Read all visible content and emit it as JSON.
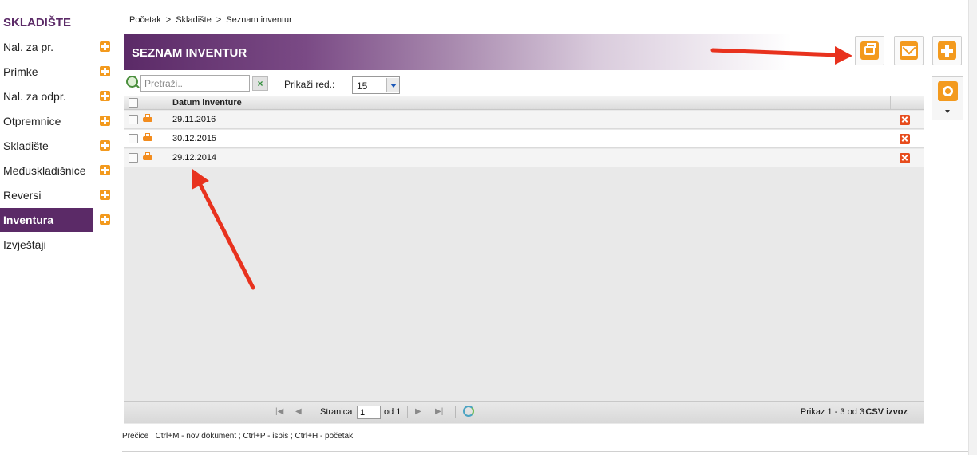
{
  "sidebar": {
    "title": "SKLADIŠTE",
    "items": [
      {
        "label": "Nal. za pr.",
        "has_add": true,
        "active": false
      },
      {
        "label": "Primke",
        "has_add": true,
        "active": false
      },
      {
        "label": "Nal. za odpr.",
        "has_add": true,
        "active": false
      },
      {
        "label": "Otpremnice",
        "has_add": true,
        "active": false
      },
      {
        "label": "Skladište",
        "has_add": true,
        "active": false
      },
      {
        "label": "Međuskladišnice",
        "has_add": true,
        "active": false
      },
      {
        "label": "Reversi",
        "has_add": true,
        "active": false
      },
      {
        "label": "Inventura",
        "has_add": true,
        "active": true
      },
      {
        "label": "Izvještaji",
        "has_add": false,
        "active": false
      }
    ]
  },
  "breadcrumb": {
    "items": [
      "Početak",
      "Skladište",
      "Seznam inventur"
    ],
    "separator": ">"
  },
  "header": {
    "title": "SEZNAM INVENTUR"
  },
  "actions": [
    {
      "name": "print",
      "icon": "printer-icon"
    },
    {
      "name": "email",
      "icon": "envelope-icon"
    },
    {
      "name": "add",
      "icon": "plus-icon"
    }
  ],
  "settings": {
    "icon": "gear-icon"
  },
  "toolbar": {
    "search_placeholder": "Pretraži..",
    "search_value": "",
    "clear_label": "×",
    "rows_label": "Prikaži red.:",
    "rows_value": "15"
  },
  "table": {
    "columns": [
      "Datum inventure"
    ],
    "rows": [
      {
        "date": "29.11.2016"
      },
      {
        "date": "30.12.2015"
      },
      {
        "date": "29.12.2014"
      }
    ]
  },
  "pager": {
    "page_label": "Stranica",
    "page_value": "1",
    "of_label": "od 1",
    "info": "Prikaz 1 - 3 od 3",
    "csv_label": "CSV izvoz"
  },
  "shortcuts": "Prečice : Ctrl+M - nov dokument ;  Ctrl+P - ispis ;  Ctrl+H - početak",
  "colors": {
    "brand_purple": "#5b2a67",
    "accent_orange": "#f39a1e",
    "delete_red": "#e74c1c",
    "annotation_arrow": "#e8321e"
  }
}
